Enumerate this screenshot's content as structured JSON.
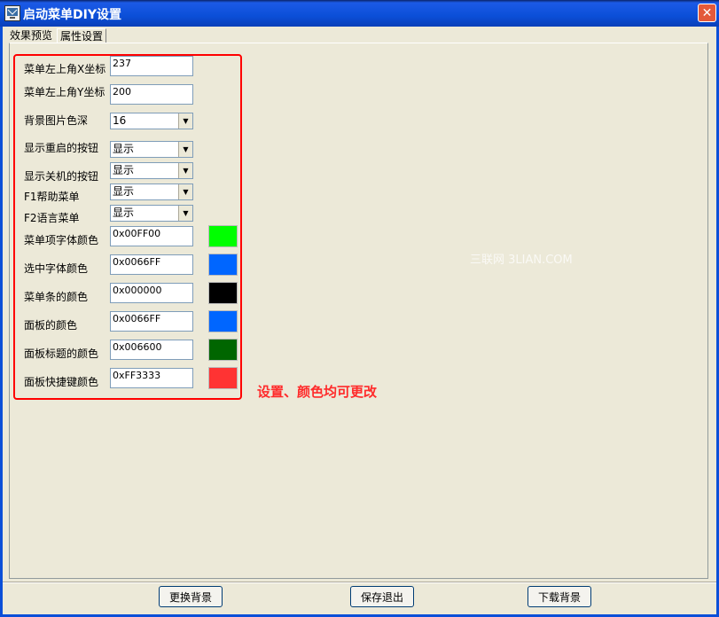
{
  "window": {
    "title": "启动菜单DIY设置",
    "close_glyph": "✕",
    "icon": "app-icon"
  },
  "tabs": [
    {
      "label": "效果预览",
      "active": false
    },
    {
      "label": "属性设置",
      "active": true
    }
  ],
  "fields": {
    "menu_x": {
      "label": "菜单左上角X坐标",
      "value": "237"
    },
    "menu_y": {
      "label": "菜单左上角Y坐标",
      "value": "200"
    },
    "bg_depth": {
      "label": "背景图片色深",
      "value": "16"
    },
    "show_restart": {
      "label": "显示重启的按钮",
      "value": "显示"
    },
    "show_shutdown": {
      "label": "显示关机的按钮",
      "value": "显示"
    },
    "f1_help": {
      "label": "F1帮助菜单",
      "value": "显示"
    },
    "f2_lang": {
      "label": "F2语言菜单",
      "value": "显示"
    }
  },
  "colors": [
    {
      "label": "菜单项字体颜色",
      "value": "0x00FF00",
      "swatch": "#00ff00"
    },
    {
      "label": "选中字体颜色",
      "value": "0x0066FF",
      "swatch": "#0066ff"
    },
    {
      "label": "菜单条的颜色",
      "value": "0x000000",
      "swatch": "#000000"
    },
    {
      "label": "面板的颜色",
      "value": "0x0066FF",
      "swatch": "#0066ff"
    },
    {
      "label": "面板标题的颜色",
      "value": "0x006600",
      "swatch": "#006600"
    },
    {
      "label": "面板快捷键颜色",
      "value": "0xFF3333",
      "swatch": "#ff3333"
    }
  ],
  "annotation": "设置、颜色均可更改",
  "watermark": "三联网 3LIAN.COM",
  "buttons": {
    "change_bg": "更换背景",
    "save_exit": "保存退出",
    "download_bg": "下载背景"
  },
  "accent": {
    "titlebar": "#0b4fd8",
    "highlight": "#ff0000"
  }
}
